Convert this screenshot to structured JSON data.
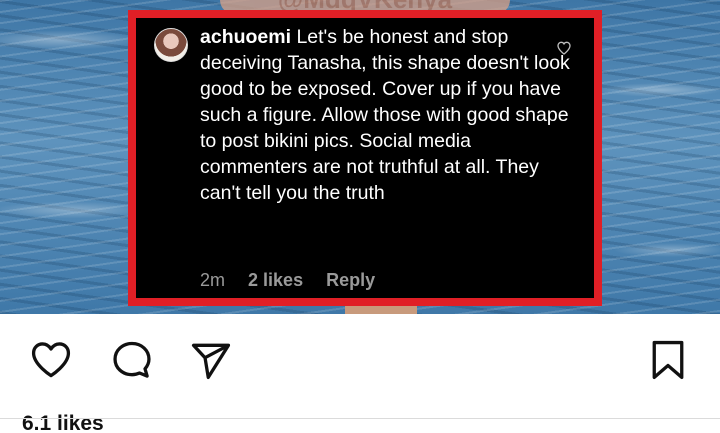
{
  "post_image": {
    "watermark": "@MdqVKenya"
  },
  "comment": {
    "username": "achuoemi",
    "text": "Let's be honest and stop deceiving Tanasha, this shape doesn't look good to be exposed. Cover up if you have such a figure. Allow those with good shape to post bikini pics. Social media commenters are not truthful at all. They can't tell you the truth",
    "time": "2m",
    "likes": "2 likes",
    "reply": "Reply"
  },
  "actions": {
    "like_icon": "heart-icon",
    "comment_icon": "comment-bubble-icon",
    "share_icon": "paper-plane-icon",
    "save_icon": "bookmark-icon"
  },
  "footer": {
    "likes_count": "6.1 likes"
  },
  "colors": {
    "highlight_border": "#e01f26",
    "comment_bg": "#000000",
    "meta_text": "#9a9a9a"
  }
}
